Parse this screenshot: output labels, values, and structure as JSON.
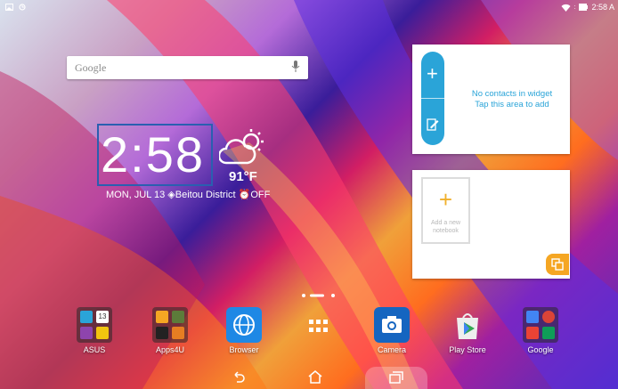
{
  "status": {
    "time": "2:58 A"
  },
  "search": {
    "placeholder": "Google"
  },
  "clock": {
    "time": "2:58"
  },
  "weather": {
    "temp": "91°F"
  },
  "date_line": "MON, JUL 13 ◈Beitou District ⏰OFF",
  "contacts_widget": {
    "line1": "No contacts in widget",
    "line2": "Tap this area to add"
  },
  "notebook_widget": {
    "add_label_1": "Add a new",
    "add_label_2": "notebook"
  },
  "apps": [
    {
      "label": "ASUS"
    },
    {
      "label": "Apps4U"
    },
    {
      "label": "Browser"
    },
    {
      "label": ""
    },
    {
      "label": "Camera"
    },
    {
      "label": "Play Store"
    },
    {
      "label": "Google"
    }
  ],
  "colors": {
    "accent_blue": "#2aa4d8",
    "notebook_yellow": "#f5a623",
    "focus_outline": "#2a5fb0"
  }
}
